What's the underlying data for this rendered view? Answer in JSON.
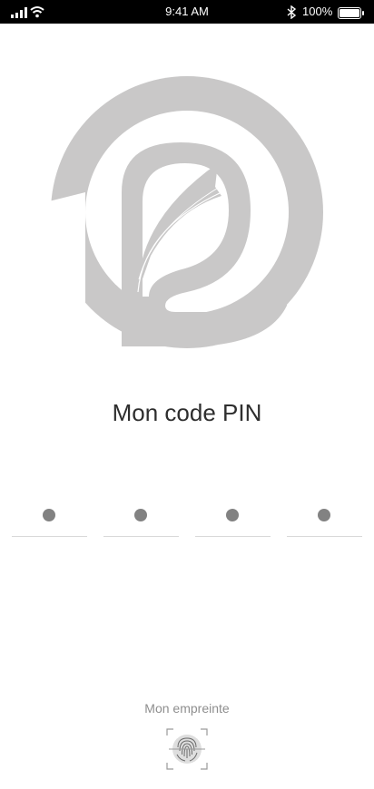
{
  "status_bar": {
    "time": "9:41 AM",
    "battery_percent": "100%",
    "icons": [
      "signal-icon",
      "wifi-icon",
      "bluetooth-icon",
      "battery-icon"
    ],
    "battery_level": 1.0
  },
  "logo": {
    "icon": "app-logo",
    "color": "#c9c8c8"
  },
  "pin": {
    "title": "Mon code PIN",
    "length": 4,
    "filled": 4,
    "dot_color": "#828282"
  },
  "fingerprint": {
    "label": "Mon empreinte",
    "icon": "fingerprint-icon"
  }
}
